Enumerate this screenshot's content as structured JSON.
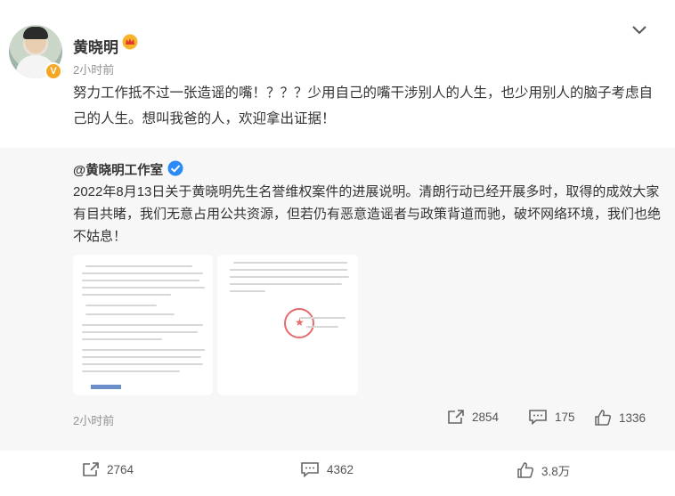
{
  "post": {
    "author": "黄晓明",
    "time": "2小时前",
    "content": "努力工作抵不过一张造谣的嘴！？？？少用自己的嘴干涉别人的人生，也少用别人的脑子考虑自己的人生。想叫我爸的人，欢迎拿出证据！",
    "actions": {
      "reposts": "2764",
      "comments": "4362",
      "likes": "3.8万"
    }
  },
  "repost": {
    "author": "@黄晓明工作室",
    "content": "2022年8月13日关于黄晓明先生名誉维权案件的进展说明。清朗行动已经开展多时，取得的成效大家有目共睹，我们无意占用公共资源，但若仍有恶意造谣者与政策背道而驰，破坏网络环境，我们也绝不姑息！",
    "time": "2小时前",
    "actions": {
      "reposts": "2854",
      "comments": "175",
      "likes": "1336"
    }
  },
  "icons": {
    "badge": "verified-v-icon",
    "crown": "crown-icon",
    "more": "chevron-down-icon",
    "share": "share-icon",
    "comment": "comment-icon",
    "like": "thumbs-up-icon"
  },
  "colors": {
    "badge": "#f6a623",
    "verified_blue": "#2a8af6",
    "gray_text": "#939393",
    "repost_bg": "#f7f7f7"
  }
}
